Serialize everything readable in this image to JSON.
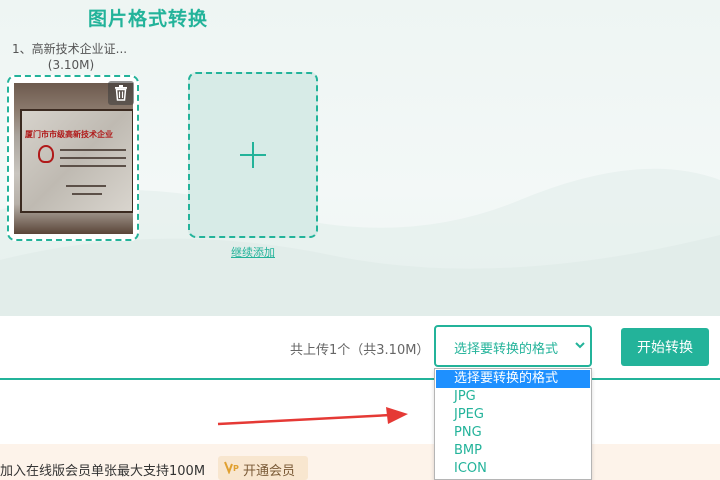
{
  "page": {
    "title": "图片格式转换",
    "accent_color": "#23b39a"
  },
  "files": [
    {
      "name": "1、高新技术企业证...",
      "size": "(3.10M)",
      "thumbnail_text": "厦门市市级高新技术企业",
      "delete_icon": "trash-icon"
    }
  ],
  "add_more": {
    "icon": "plus-icon",
    "label": "继续添加"
  },
  "toolbar": {
    "upload_summary": "共上传1个（共3.10M）",
    "format_select": {
      "selected": "选择要转换的格式",
      "options": [
        "选择要转换的格式",
        "JPG",
        "JPEG",
        "PNG",
        "BMP",
        "ICON"
      ]
    },
    "start_button": "开始转换"
  },
  "promo": {
    "text": "加入在线版会员单张最大支持100M",
    "vip_button": "开通会员",
    "vip_icon": "vip-icon"
  },
  "annotation": {
    "arrow_color": "#e53935"
  }
}
